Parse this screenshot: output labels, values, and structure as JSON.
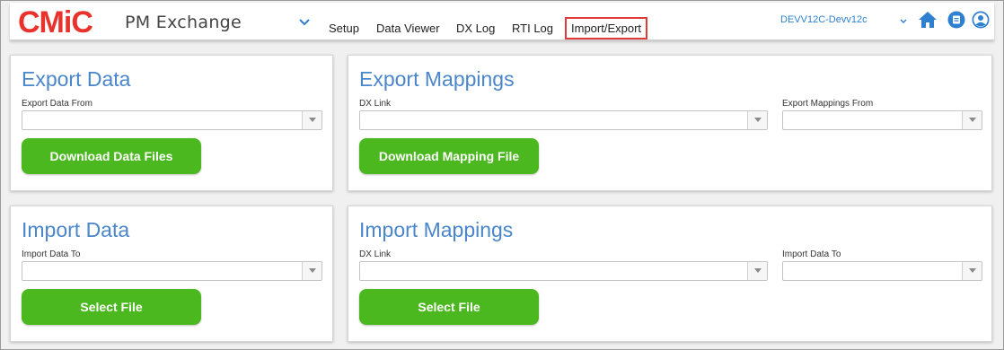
{
  "brand": {
    "logo_text": "CMiC",
    "app_name": "PM Exchange"
  },
  "nav": {
    "items": [
      {
        "label": "Setup"
      },
      {
        "label": "Data Viewer"
      },
      {
        "label": "DX Log"
      },
      {
        "label": "RTI Log"
      },
      {
        "label": "Import/Export",
        "active": true
      }
    ]
  },
  "header": {
    "environment": "DEVV12C-Devv12c",
    "icons": [
      "chevron-down-icon",
      "home-icon",
      "notes-icon",
      "user-icon"
    ]
  },
  "export_data": {
    "title": "Export Data",
    "from_label": "Export Data From",
    "from_value": "",
    "button": "Download Data Files"
  },
  "export_mappings": {
    "title": "Export Mappings",
    "dx_link_label": "DX Link",
    "dx_link_value": "",
    "from_label": "Export Mappings From",
    "from_value": "",
    "button": "Download Mapping File"
  },
  "import_data": {
    "title": "Import Data",
    "to_label": "Import Data To",
    "to_value": "",
    "button": "Select File"
  },
  "import_mappings": {
    "title": "Import Mappings",
    "dx_link_label": "DX Link",
    "dx_link_value": "",
    "to_label": "Import Data To",
    "to_value": "",
    "button": "Select File"
  },
  "colors": {
    "brand_red": "#e8322b",
    "accent_blue": "#4a86c9",
    "button_green": "#4cb81f",
    "active_outline": "#e03a3a"
  }
}
